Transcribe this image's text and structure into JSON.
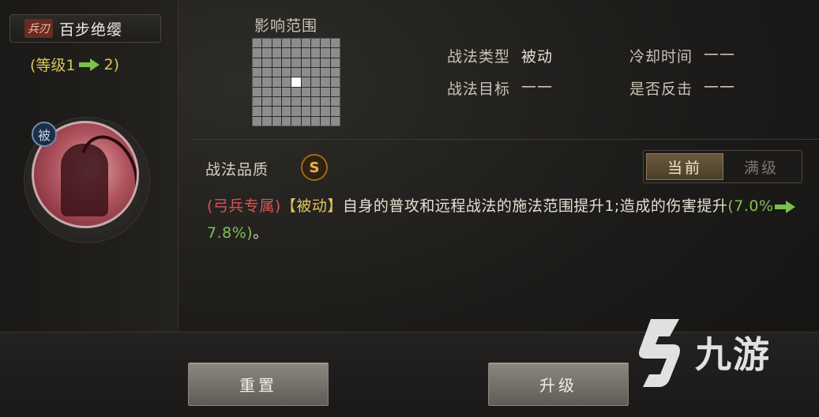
{
  "tactic": {
    "weapon_tag": "兵刃",
    "name": "百步绝缨",
    "level_prefix": "(等级1",
    "level_suffix": "2)",
    "passive_badge": "被"
  },
  "range": {
    "label": "影响范围",
    "grid_size": 9
  },
  "info": {
    "type_label": "战法类型",
    "type_value": "被动",
    "cooldown_label": "冷却时间",
    "cooldown_value": "——",
    "target_label": "战法目标",
    "target_value": "——",
    "counter_label": "是否反击",
    "counter_value": "——"
  },
  "quality": {
    "label": "战法品质",
    "grade": "S"
  },
  "toggle": {
    "current": "当前",
    "max": "满级"
  },
  "description": {
    "exclusive": "(弓兵专属)",
    "type_tag": "【被动】",
    "text": "自身的普攻和远程战法的施法范围提升1;造成的伤害提升",
    "open": "(",
    "from": "7.0%",
    "to": "7.8%",
    "close": ")",
    "end": "。"
  },
  "buttons": {
    "reset": "重置",
    "upgrade": "升级"
  },
  "watermark": {
    "text": "九游"
  },
  "colors": {
    "accent_gold": "#d9c45a",
    "upgrade_green": "#79c14a",
    "exclusive_red": "#d85454"
  }
}
